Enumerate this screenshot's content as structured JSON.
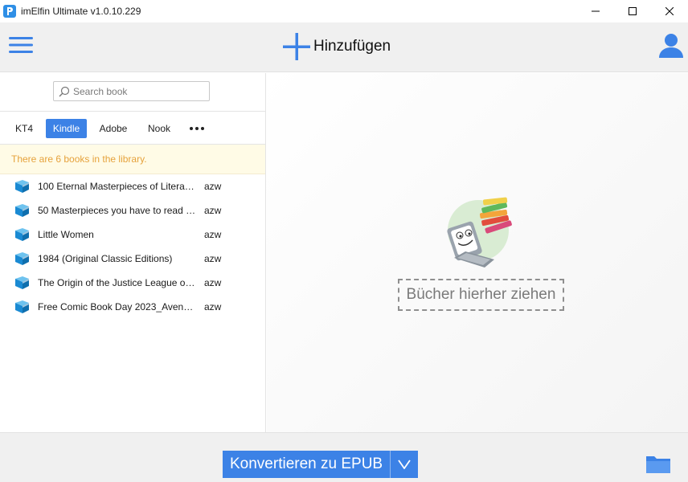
{
  "window": {
    "title": "imElfin Ultimate v1.0.10.229",
    "controls": [
      "minimize",
      "maximize",
      "close"
    ]
  },
  "toolbar": {
    "menu_icon": "hamburger-menu-icon",
    "add_label": "Hinzufügen",
    "user_icon": "user-profile-icon"
  },
  "search": {
    "placeholder": "Search book",
    "value": ""
  },
  "tabs": [
    {
      "label": "KT4",
      "active": false
    },
    {
      "label": "Kindle",
      "active": true
    },
    {
      "label": "Adobe",
      "active": false
    },
    {
      "label": "Nook",
      "active": false
    }
  ],
  "library_notice": "There are 6 books in the library.",
  "books": [
    {
      "title": "100 Eternal Masterpieces of Litera…",
      "format": "azw"
    },
    {
      "title": "50 Masterpieces you have to read …",
      "format": "azw"
    },
    {
      "title": "Little Women",
      "format": "azw"
    },
    {
      "title": "1984 (Original Classic Editions)",
      "format": "azw"
    },
    {
      "title": "The Origin of the Justice League o…",
      "format": "azw"
    },
    {
      "title": "Free Comic Book Day 2023_Aven…",
      "format": "azw"
    }
  ],
  "drop_zone_label": "Bücher hierher ziehen",
  "convert": {
    "label": "Konvertieren zu EPUB",
    "dropdown_icon": "chevron-down-icon"
  },
  "colors": {
    "accent": "#3c82e6",
    "notice_text": "#e6a23c",
    "notice_bg": "#fffbe6"
  }
}
